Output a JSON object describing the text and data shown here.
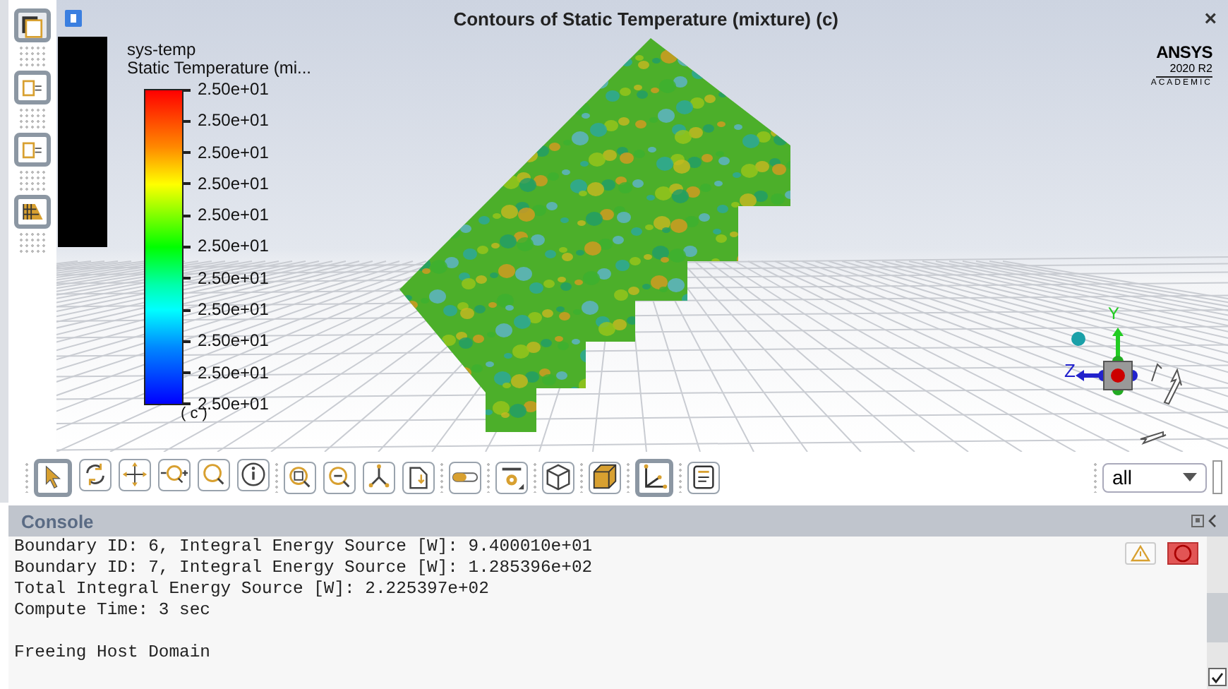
{
  "window": {
    "title": "Contours of Static Temperature (mixture)  (c)",
    "close": "×"
  },
  "logo": {
    "brand": "ANSYS",
    "version": "2020 R2",
    "edition": "ACADEMIC"
  },
  "legend": {
    "title": "sys-temp",
    "quantity": "Static Temperature (mi...",
    "ticks": [
      "2.50e+01",
      "2.50e+01",
      "2.50e+01",
      "2.50e+01",
      "2.50e+01",
      "2.50e+01",
      "2.50e+01",
      "2.50e+01",
      "2.50e+01",
      "2.50e+01",
      "2.50e+01"
    ],
    "footer": "( c )"
  },
  "triad": {
    "y_label": "Y",
    "z_label": "Z"
  },
  "toolbar": {
    "groups": [
      [
        {
          "selected": true
        },
        {
          "selected": false
        },
        {
          "selected": false
        },
        {
          "selected": false
        },
        {
          "selected": false
        },
        {
          "selected": false
        }
      ],
      [
        {
          "selected": false
        },
        {
          "selected": false
        },
        {
          "selected": false
        },
        {
          "selected": false
        }
      ],
      [
        {
          "selected": false
        }
      ],
      [
        {
          "selected": false
        }
      ],
      [
        {
          "selected": false
        }
      ],
      [
        {
          "selected": false
        }
      ],
      [
        {
          "selected": true
        }
      ],
      [
        {
          "selected": false
        }
      ]
    ],
    "view_select": "all"
  },
  "console": {
    "title": "Console",
    "blocks": [
      [
        "Boundary ID: 6, Integral Energy Source [W]: 9.400010e+01",
        "Boundary ID: 7, Integral Energy Source [W]: 1.285396e+02",
        "Total Integral Energy Source [W]: 2.225397e+02",
        "Compute Time:  3 sec"
      ],
      [
        "Freeing Host Domain"
      ]
    ],
    "autoscroll": true
  }
}
